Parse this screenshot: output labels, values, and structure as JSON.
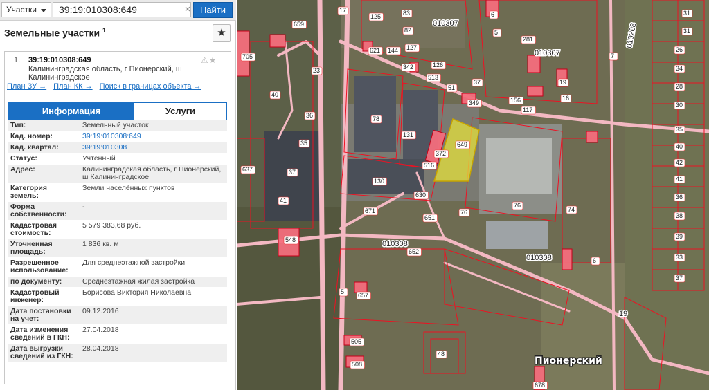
{
  "search": {
    "type_label": "Участки",
    "value": "39:19:010308:649",
    "clear_glyph": "×",
    "button_label": "Найти"
  },
  "panel": {
    "title": "Земельные участки",
    "title_sup": "1",
    "star_glyph": "★"
  },
  "result": {
    "number": "1.",
    "cadastral": "39:19:010308:649",
    "address_short": "Калининградская область, г Пионерский, ш Калининградское",
    "action_icons": "⚠★",
    "links": [
      "План ЗУ →",
      "План КК →",
      "Поиск в границах объекта →"
    ]
  },
  "tabs": {
    "info": "Информация",
    "services": "Услуги"
  },
  "rows": [
    {
      "k": "Тип:",
      "v": "Земельный участок"
    },
    {
      "k": "Кад. номер:",
      "v": "39:19:010308:649"
    },
    {
      "k": "Кад. квартал:",
      "v": "39:19:010308"
    },
    {
      "k": "Статус:",
      "v": "Учтенный"
    },
    {
      "k": "Адрес:",
      "v": "Калининградская область, г Пионерский, ш Калининградское"
    },
    {
      "k": "Категория земель:",
      "v": "Земли населённых пунктов"
    },
    {
      "k": "Форма собственности:",
      "v": "-"
    },
    {
      "k": "Кадастровая стоимость:",
      "v": "5 579 383,68 руб."
    },
    {
      "k": "Уточненная площадь:",
      "v": "1 836 кв. м"
    },
    {
      "k": "Разрешенное использование:",
      "v": "Для среднеэтажной застройки"
    },
    {
      "k": "по документу:",
      "v": "Среднеэтажная жилая застройка"
    },
    {
      "k": "Кадастровый инженер:",
      "v": "Борисова Виктория Николаевна"
    },
    {
      "k": "Дата постановки на учет:",
      "v": "09.12.2016"
    },
    {
      "k": "Дата изменения сведений в ГКН:",
      "v": "27.04.2018"
    },
    {
      "k": "Дата выгрузки сведений из ГКН:",
      "v": "28.04.2018"
    }
  ],
  "map": {
    "quarters": [
      "010307",
      "010307",
      "010308",
      "010308",
      "010208"
    ],
    "city": "Пионерский",
    "selected_plot": "649",
    "number_19": "19",
    "plot_labels": [
      "659",
      "23",
      "17",
      "40",
      "36",
      "35",
      "37",
      "41",
      "637",
      "705",
      "125",
      "83",
      "82",
      "6",
      "5",
      "621",
      "144",
      "127",
      "342",
      "126",
      "513",
      "51",
      "37",
      "349",
      "156",
      "281",
      "7",
      "117",
      "16",
      "19",
      "78",
      "131",
      "516",
      "372",
      "649",
      "130",
      "630",
      "651",
      "671",
      "76",
      "76",
      "74",
      "6",
      "548",
      "652",
      "5",
      "657",
      "505",
      "508",
      "48",
      "678",
      "31",
      "31",
      "26",
      "34",
      "28",
      "30",
      "35",
      "40",
      "42",
      "41",
      "36",
      "38",
      "39",
      "33",
      "37"
    ],
    "colors": {
      "plot_line": "#ee1122",
      "plot_fill": "#f36e7c",
      "road": "#f3b8c2",
      "selected": "#e6e23c"
    }
  }
}
